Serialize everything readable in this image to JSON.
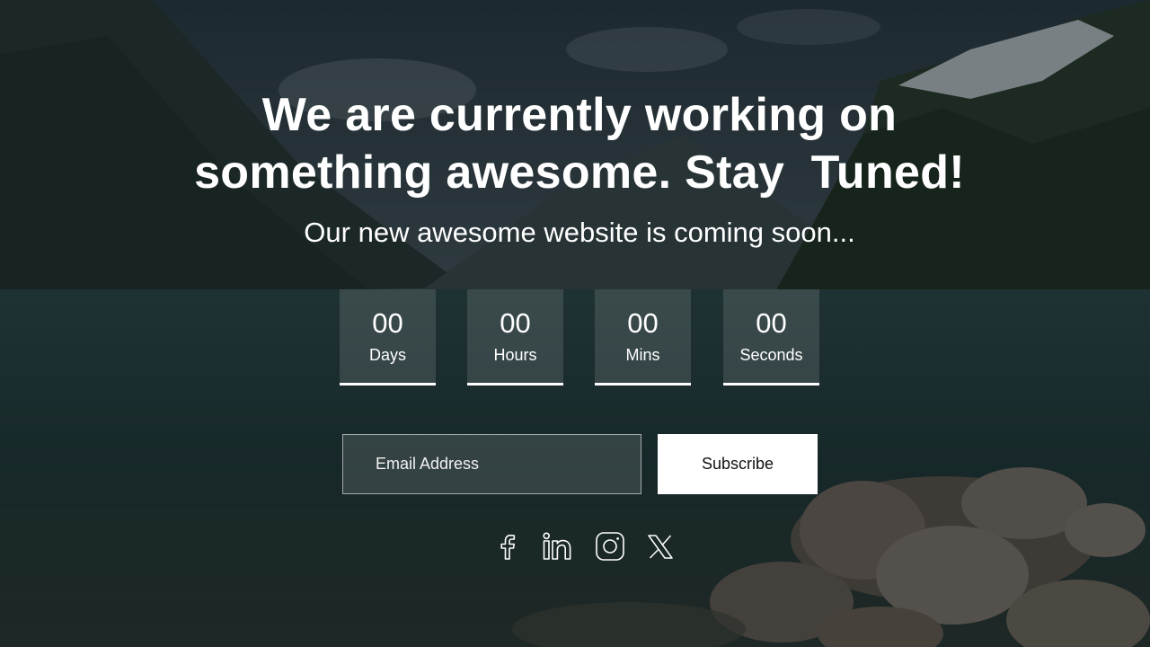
{
  "hero": {
    "headline_line1": "We are currently working on",
    "headline_line2": "something awesome. Stay  Tuned!",
    "subheadline": "Our new awesome website is coming soon..."
  },
  "countdown": [
    {
      "value": "00",
      "label": "Days"
    },
    {
      "value": "00",
      "label": "Hours"
    },
    {
      "value": "00",
      "label": "Mins"
    },
    {
      "value": "00",
      "label": "Seconds"
    }
  ],
  "subscribe": {
    "email_placeholder": "Email Address",
    "email_value": "",
    "button_label": "Subscribe"
  },
  "socials": [
    {
      "icon": "facebook-icon"
    },
    {
      "icon": "linkedin-icon"
    },
    {
      "icon": "instagram-icon"
    },
    {
      "icon": "x-twitter-icon"
    }
  ],
  "colors": {
    "text": "#ffffff",
    "button_bg": "#ffffff",
    "button_text": "#111111",
    "overlay": "#0a1012"
  }
}
